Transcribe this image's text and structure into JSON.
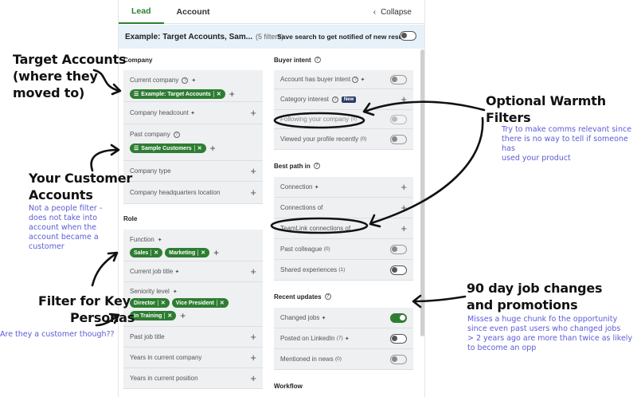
{
  "tabs": [
    "Lead",
    "Account"
  ],
  "collapse_label": "Collapse",
  "search": {
    "title": "Example: Target Accounts, Sam...",
    "count": "(5 filters)",
    "save_label": "Save search to get notified of new results"
  },
  "left": {
    "company_section": "Company",
    "current_company": "Current company",
    "current_company_pill": "Example: Target Accounts",
    "company_headcount": "Company headcount",
    "past_company": "Past company",
    "past_company_pill": "Sample Customers",
    "company_type": "Company type",
    "company_hq": "Company headquarters location",
    "role_section": "Role",
    "function": "Function",
    "function_pills": [
      "Sales",
      "Marketing"
    ],
    "current_job_title": "Current job title",
    "seniority_level": "Seniority level",
    "seniority_pills": [
      "Director",
      "Vice President",
      "In Training"
    ],
    "past_job_title": "Past job title",
    "years_company": "Years in current company",
    "years_position": "Years in current position"
  },
  "right": {
    "buyer_section": "Buyer intent",
    "account_buyer_intent": "Account has buyer intent",
    "category_interest": "Category interest",
    "new_badge": "New",
    "following_company": "Following your company",
    "following_count": "(0)",
    "viewed_profile": "Viewed your profile recently",
    "viewed_count": "(0)",
    "best_path_section": "Best path in",
    "connection": "Connection",
    "connections_of": "Connections of",
    "teamlink": "TeamLink connections of",
    "past_colleague": "Past colleague",
    "past_colleague_count": "(0)",
    "shared_experiences": "Shared experiences",
    "shared_count": "(1)",
    "recent_updates_section": "Recent updates",
    "changed_jobs": "Changed jobs",
    "posted_linkedin": "Posted on LinkedIn",
    "posted_count": "(7)",
    "mentioned_news": "Mentioned in news",
    "mentioned_count": "(0)",
    "workflow_section": "Workflow"
  },
  "annotations": {
    "target_accounts": [
      "Target Accounts",
      "(where they",
      "moved to)"
    ],
    "customer_accounts": [
      "Your Customer",
      "Accounts"
    ],
    "customer_note": [
      "Not a people filter -",
      "does not take into",
      "account when the",
      "account became a",
      "customer"
    ],
    "key_personas": [
      "Filter for Key",
      "Personas"
    ],
    "customer_question": "Are they a customer though??",
    "warmth": [
      "Optional Warmth",
      "Filters"
    ],
    "warmth_note": [
      "Try to make comms relevant since",
      "there is no way to tell if someone has",
      "used  your product"
    ],
    "job_changes": [
      "90 day job changes",
      "and promotions"
    ],
    "job_note": [
      "Misses a huge chunk fo the opportunity",
      "since  even past users who changed jobs",
      "> 2 years ago are more than twice as likely",
      "to become an opp"
    ]
  }
}
